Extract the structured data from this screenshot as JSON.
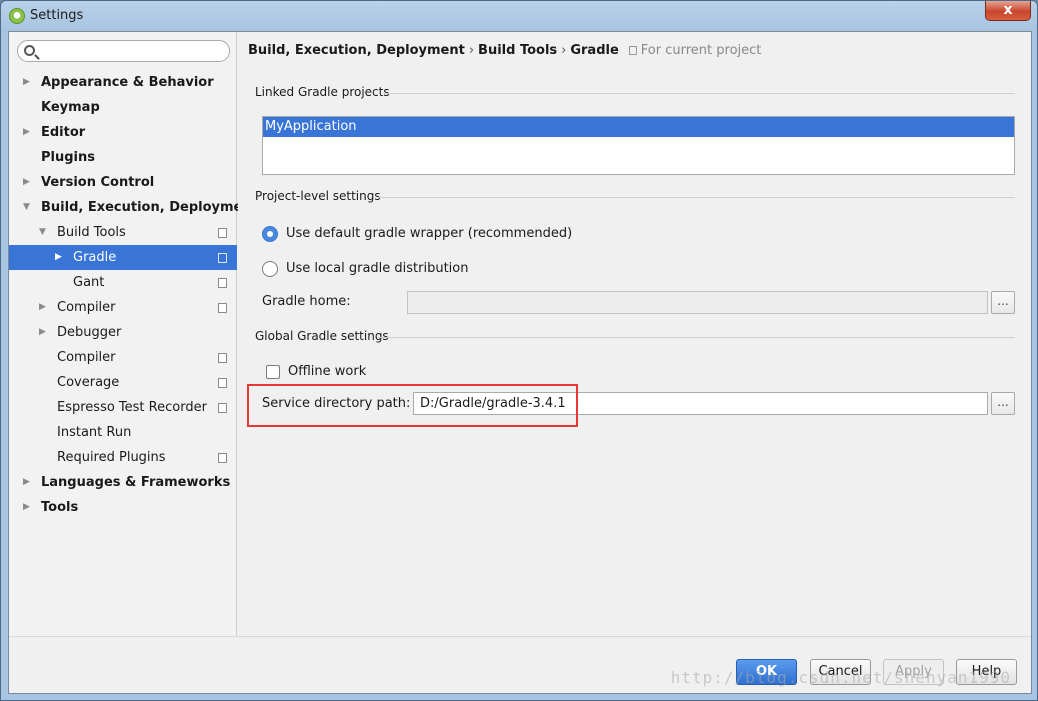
{
  "window": {
    "title": "Settings",
    "close_glyph": "x"
  },
  "search": {
    "placeholder": "",
    "value": ""
  },
  "sidebar": {
    "items": [
      {
        "label": "Appearance & Behavior",
        "arrow": "▶",
        "bold": true
      },
      {
        "label": "Keymap",
        "arrow": "",
        "bold": true
      },
      {
        "label": "Editor",
        "arrow": "▶",
        "bold": true
      },
      {
        "label": "Plugins",
        "arrow": "",
        "bold": true
      },
      {
        "label": "Version Control",
        "arrow": "▶",
        "bold": true
      },
      {
        "label": "Build, Execution, Deployment",
        "arrow": "▼",
        "bold": true
      },
      {
        "label": "Build Tools",
        "arrow": "▼",
        "copy": true
      },
      {
        "label": "Gradle",
        "arrow": "▶",
        "copy": true,
        "selected": true
      },
      {
        "label": "Gant",
        "arrow": "",
        "copy": true
      },
      {
        "label": "Compiler",
        "arrow": "▶",
        "copy": true
      },
      {
        "label": "Debugger",
        "arrow": "▶"
      },
      {
        "label": "Compiler",
        "arrow": "",
        "copy": true
      },
      {
        "label": "Coverage",
        "arrow": "",
        "copy": true
      },
      {
        "label": "Espresso Test Recorder",
        "arrow": "",
        "copy": true
      },
      {
        "label": "Instant Run",
        "arrow": ""
      },
      {
        "label": "Required Plugins",
        "arrow": "",
        "copy": true
      },
      {
        "label": "Languages & Frameworks",
        "arrow": "▶",
        "bold": true
      },
      {
        "label": "Tools",
        "arrow": "▶",
        "bold": true
      }
    ]
  },
  "breadcrumb": {
    "part1": "Build, Execution, Deployment",
    "part2": "Build Tools",
    "part3": "Gradle",
    "separator": "›",
    "scope": "For current project"
  },
  "linked": {
    "section_title": "Linked Gradle projects",
    "projects": [
      "MyApplication"
    ]
  },
  "project_level": {
    "section_title": "Project-level settings",
    "radio_default": "Use default gradle wrapper (recommended)",
    "radio_local": "Use local gradle distribution",
    "gradle_home_label": "Gradle home:",
    "gradle_home_value": "",
    "browse_glyph": "..."
  },
  "global": {
    "section_title": "Global Gradle settings",
    "offline_label": "Offline work",
    "service_dir_label": "Service directory path:",
    "service_dir_value": "D:/Gradle/gradle-3.4.1",
    "browse_glyph": "..."
  },
  "buttons": {
    "ok": "OK",
    "cancel": "Cancel",
    "apply": "Apply",
    "help": "Help"
  },
  "watermark": "http://blog.csdn.net/shenyan1990",
  "colors": {
    "selection": "#3875d7",
    "highlight_border": "#e53935"
  }
}
